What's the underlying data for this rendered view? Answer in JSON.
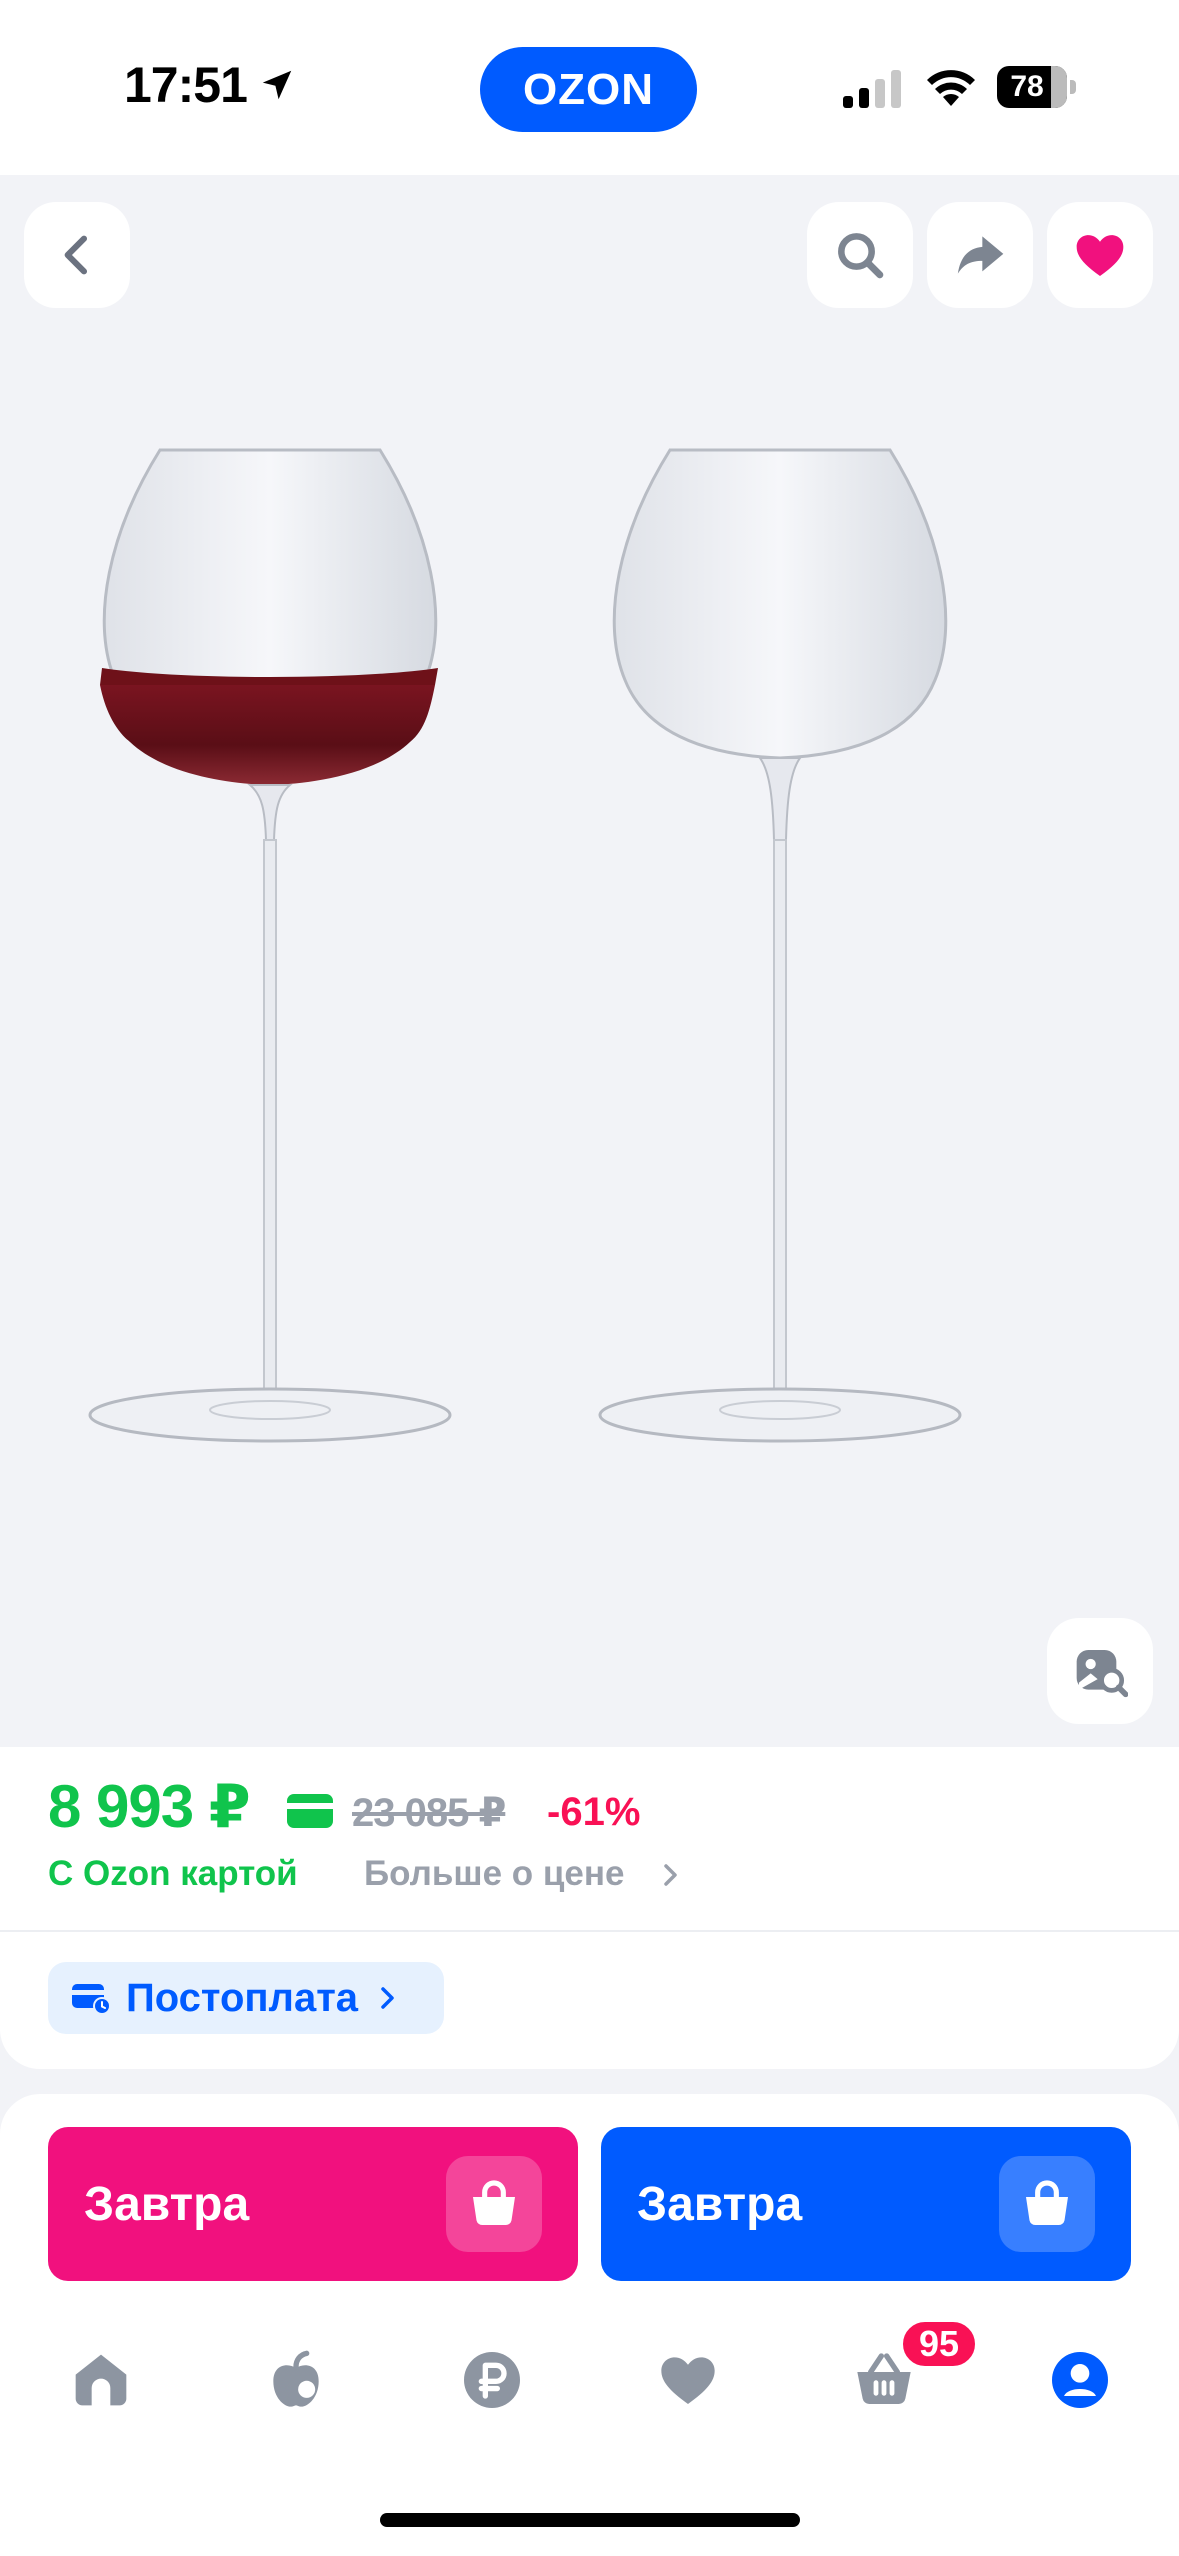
{
  "status_bar": {
    "time": "17:51",
    "battery": "78"
  },
  "app": {
    "logo": "OZON",
    "brand_color": "#005bff"
  },
  "nav": {
    "back_icon": "chevron-left-icon",
    "search_icon": "search-icon",
    "share_icon": "share-icon",
    "favorite_icon": "heart-icon",
    "favorite_active": true,
    "similar_icon": "image-search-icon"
  },
  "product": {
    "image": "two-wine-glasses"
  },
  "price": {
    "current": "8 993 ₽",
    "old": "23 085 ₽",
    "discount": "-61%",
    "card_label": "С Ozon картой",
    "more_label": "Больше о цене",
    "colors": {
      "card_price": "#10c44c",
      "discount": "#f91155",
      "old": "#9aa0ab"
    }
  },
  "postpay": {
    "label": "Постоплата"
  },
  "actions": {
    "buy_pink_label": "Завтра",
    "buy_blue_label": "Завтра",
    "colors": {
      "pink": "#f1117e",
      "blue": "#005bff"
    }
  },
  "tabbar": {
    "items": [
      {
        "name": "home",
        "icon": "home-icon"
      },
      {
        "name": "fresh",
        "icon": "apple-icon"
      },
      {
        "name": "finance",
        "icon": "ruble-icon"
      },
      {
        "name": "favorites",
        "icon": "heart-icon"
      },
      {
        "name": "cart",
        "icon": "basket-icon"
      },
      {
        "name": "profile",
        "icon": "profile-icon"
      }
    ],
    "cart_badge": "95",
    "active": "profile"
  }
}
